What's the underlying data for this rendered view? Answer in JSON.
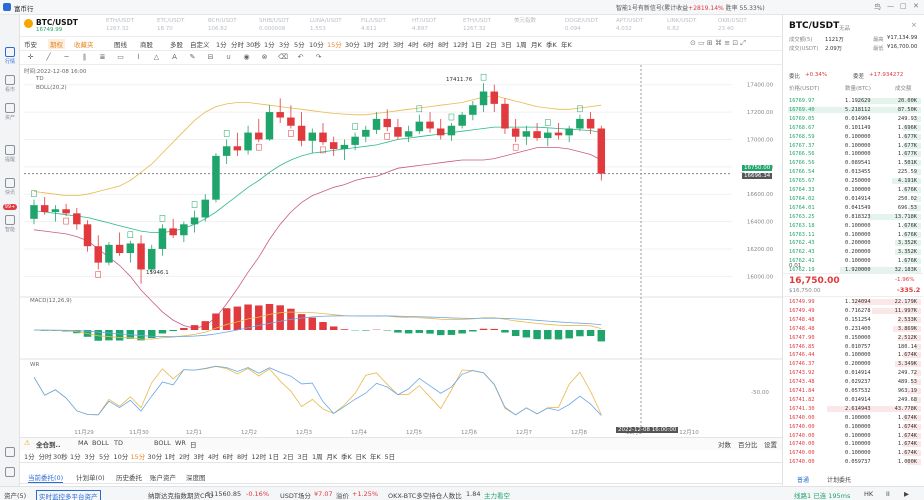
{
  "titlebar": {
    "app_name": "富币行",
    "notice": "智能1号有新信号(累计收益",
    "notice_value": "+2819.14%",
    "notice_tail": "胜率 55.33%)",
    "buttons": [
      "鸟",
      "—",
      "□",
      "✕"
    ]
  },
  "sidebar": {
    "items": [
      {
        "label": "行情",
        "icon": "chart-icon",
        "active": true
      },
      {
        "label": "看市",
        "icon": "eye-icon"
      },
      {
        "label": "资产",
        "icon": "wallet-icon"
      },
      {
        "label": "提醒",
        "icon": "bell-icon"
      },
      {
        "label": "快讯",
        "icon": "news-icon"
      },
      {
        "label": "99+",
        "icon": "badge-icon"
      },
      {
        "label": "智能",
        "icon": "robot-icon"
      }
    ]
  },
  "symbol": {
    "name": "BTC/USDT",
    "price": "16749.99"
  },
  "tickers": [
    {
      "name": "ETH/USDT",
      "price": "1267.32"
    },
    {
      "name": "ETC/USDT",
      "price": "18.70"
    },
    {
      "name": "BCH/USDT",
      "price": "106.82"
    },
    {
      "name": "SHIB/USDT",
      "price": "0.000008"
    },
    {
      "name": "LUNA/USDT",
      "price": "1.553"
    },
    {
      "name": "FIL/USDT",
      "price": "4.611"
    },
    {
      "name": "HT/USDT",
      "price": "4.897"
    },
    {
      "name": "ETH/USDT",
      "price": "1267.32"
    },
    {
      "name": "美元指数",
      "price": ""
    },
    {
      "name": "DOGE/USDT",
      "price": "0.094"
    },
    {
      "name": "APT/USDT",
      "price": "4.032"
    },
    {
      "name": "LINK/USDT",
      "price": "6.82"
    },
    {
      "name": "OKB/USDT",
      "price": "23.40"
    }
  ],
  "toolbar1": {
    "exchange": "币安",
    "contract": "期权",
    "fav": "收藏夹",
    "tabs": [
      "图线",
      "商股",
      "多股",
      "自定义"
    ],
    "intervals": [
      "1分",
      "分时",
      "30秒",
      "1分",
      "3分",
      "5分",
      "10分",
      "15分",
      "30分",
      "1时",
      "2时",
      "3时",
      "4时",
      "6时",
      "8时",
      "12时",
      "1日",
      "2日",
      "3日",
      "1周",
      "月K",
      "季K",
      "年K"
    ]
  },
  "chart": {
    "timestamp_label": "时间:2022-12-08 16:00",
    "indicator_td": "TD",
    "indicator_boll": "BOLL(20,2)",
    "macd_label": "MACD(12,26,9)",
    "wr_label": "WR",
    "high_label": "17411.76",
    "low_label": "15946.1",
    "current_price_tag": "16750.00",
    "secondary_price_tag": "16696.34",
    "crosshair_time": "2022-12-08 16:00:00",
    "y_ticks": [
      "17400.00",
      "17200.00",
      "17000.00",
      "16800.00",
      "16600.00",
      "16400.00",
      "16200.00",
      "16000.00"
    ],
    "wr_ticks": [
      "-50.00"
    ],
    "x_ticks": [
      "11月29",
      "11月30",
      "12月1",
      "12月2",
      "12月3",
      "12月4",
      "12月5",
      "12月6",
      "12月7",
      "12月8",
      "12月9",
      "12月10"
    ]
  },
  "chart_data": {
    "type": "candlestick",
    "timeframe": "4h",
    "candles": [
      [
        16420,
        16560,
        16380,
        16520
      ],
      [
        16520,
        16580,
        16450,
        16470
      ],
      [
        16470,
        16520,
        16400,
        16490
      ],
      [
        16490,
        16530,
        16440,
        16460
      ],
      [
        16460,
        16500,
        16340,
        16380
      ],
      [
        16380,
        16410,
        16180,
        16220
      ],
      [
        16220,
        16300,
        16050,
        16100
      ],
      [
        16100,
        16250,
        16080,
        16230
      ],
      [
        16230,
        16320,
        16150,
        16170
      ],
      [
        16170,
        16260,
        16100,
        16240
      ],
      [
        16240,
        16300,
        15946,
        16050
      ],
      [
        16050,
        16230,
        16020,
        16200
      ],
      [
        16200,
        16380,
        16150,
        16350
      ],
      [
        16350,
        16420,
        16280,
        16300
      ],
      [
        16300,
        16400,
        16250,
        16380
      ],
      [
        16380,
        16480,
        16320,
        16430
      ],
      [
        16430,
        16600,
        16400,
        16560
      ],
      [
        16560,
        16900,
        16540,
        16880
      ],
      [
        16880,
        17000,
        16820,
        16950
      ],
      [
        16950,
        17050,
        16880,
        16920
      ],
      [
        16920,
        17100,
        16890,
        17050
      ],
      [
        17050,
        17150,
        16980,
        17000
      ],
      [
        17000,
        17250,
        16990,
        17200
      ],
      [
        17200,
        17300,
        17120,
        17160
      ],
      [
        17160,
        17250,
        17080,
        17100
      ],
      [
        17100,
        17200,
        16950,
        16990
      ],
      [
        16990,
        17080,
        16900,
        17050
      ],
      [
        17050,
        17120,
        16960,
        16980
      ],
      [
        16980,
        17020,
        16880,
        16930
      ],
      [
        16930,
        17000,
        16850,
        16960
      ],
      [
        16960,
        17050,
        16920,
        17020
      ],
      [
        17020,
        17100,
        16980,
        17070
      ],
      [
        17070,
        17200,
        17040,
        17150
      ],
      [
        17150,
        17220,
        17060,
        17090
      ],
      [
        17090,
        17150,
        17000,
        17020
      ],
      [
        17020,
        17100,
        16980,
        17060
      ],
      [
        17060,
        17180,
        17040,
        17130
      ],
      [
        17130,
        17200,
        17050,
        17080
      ],
      [
        17080,
        17150,
        17000,
        17030
      ],
      [
        17030,
        17120,
        16990,
        17100
      ],
      [
        17100,
        17200,
        17080,
        17180
      ],
      [
        17180,
        17280,
        17140,
        17250
      ],
      [
        17250,
        17411,
        17200,
        17350
      ],
      [
        17350,
        17400,
        17200,
        17260
      ],
      [
        17260,
        17300,
        17040,
        17080
      ],
      [
        17080,
        17150,
        16980,
        17020
      ],
      [
        17020,
        17100,
        16960,
        17060
      ],
      [
        17060,
        17120,
        16990,
        17010
      ],
      [
        17010,
        17080,
        16950,
        17050
      ],
      [
        17050,
        17120,
        17000,
        17030
      ],
      [
        17030,
        17100,
        16980,
        17080
      ],
      [
        17080,
        17180,
        17060,
        17150
      ],
      [
        17150,
        17200,
        17040,
        17080
      ],
      [
        17080,
        17100,
        16700,
        16750
      ]
    ],
    "boll_upper": [
      16620,
      16610,
      16600,
      16590,
      16590,
      16600,
      16620,
      16640,
      16660,
      16700,
      16760,
      16820,
      16900,
      16980,
      17060,
      17140,
      17200,
      17240,
      17260,
      17270,
      17270,
      17260,
      17250,
      17240,
      17230,
      17220,
      17210,
      17200,
      17190,
      17185,
      17180,
      17180,
      17190,
      17200,
      17210,
      17220,
      17230,
      17240,
      17250,
      17260,
      17270,
      17290,
      17310,
      17320,
      17300,
      17280,
      17260,
      17240,
      17230,
      17220,
      17220,
      17230,
      17240,
      17250
    ],
    "boll_mid": [
      16480,
      16470,
      16460,
      16450,
      16440,
      16430,
      16410,
      16390,
      16370,
      16350,
      16330,
      16320,
      16320,
      16330,
      16350,
      16380,
      16420,
      16470,
      16530,
      16590,
      16650,
      16700,
      16760,
      16810,
      16850,
      16880,
      16900,
      16910,
      16920,
      16930,
      16940,
      16950,
      16960,
      16980,
      17000,
      17010,
      17020,
      17030,
      17040,
      17050,
      17060,
      17070,
      17080,
      17090,
      17090,
      17090,
      17090,
      17090,
      17085,
      17080,
      17075,
      17070,
      17065,
      17050
    ],
    "boll_lower": [
      16340,
      16330,
      16320,
      16310,
      16290,
      16260,
      16200,
      16140,
      16080,
      16000,
      15900,
      15820,
      15740,
      15680,
      15640,
      15620,
      15640,
      15700,
      15800,
      15910,
      16030,
      16140,
      16270,
      16380,
      16470,
      16540,
      16590,
      16620,
      16650,
      16670,
      16700,
      16720,
      16730,
      16760,
      16790,
      16800,
      16810,
      16820,
      16830,
      16840,
      16850,
      16850,
      16850,
      16860,
      16880,
      16900,
      16920,
      16940,
      16940,
      16940,
      16930,
      16910,
      16890,
      16850
    ],
    "y_range": [
      15900,
      17500
    ]
  },
  "toolbar_chart": {
    "buttons": [
      "+",
      "−"
    ]
  },
  "bottombar1": {
    "items": [
      "全仓到..",
      "MA",
      "BOLL",
      "TD",
      "BOLL",
      "WR",
      "日"
    ],
    "right": [
      "对数",
      "百分比",
      "设置"
    ]
  },
  "bottombar2": {
    "intervals": [
      "1分",
      "分时",
      "30秒",
      "1分",
      "3分",
      "5分",
      "10分",
      "15分",
      "30分",
      "1时",
      "2时",
      "3时",
      "4时",
      "6时",
      "8时",
      "12时",
      "1日",
      "2日",
      "3日",
      "1周",
      "月K",
      "季K",
      "日K",
      "年K",
      "5日"
    ]
  },
  "bottomtabs": {
    "tabs": [
      "当前委托(0)",
      "计划单(0)",
      "历史委托",
      "账户资产",
      "深度图"
    ]
  },
  "statusbar": {
    "items": [
      "资产(5)",
      "实时监控多平台资产",
      "纳斯达克指数期货CFD",
      "$11560.85",
      "-0.16%",
      "USDT场分",
      "¥7.07",
      "溢价",
      "+1.25%",
      "OKX-BTC多空持仓人数比",
      "1.84",
      "主力看空"
    ],
    "latency": "线路1 已连 195ms",
    "right": [
      "HK",
      "II",
      "▶"
    ]
  },
  "rightpanel": {
    "symbol": "BTC/USDT",
    "sub": "无品",
    "vol_label": "成交额(5)",
    "vol_value": "1121万",
    "trades_label": "成交(USDT)",
    "trades_value": "2.09万",
    "high_label": "最高",
    "high_value": "¥17,134.99",
    "low_label": "最低",
    "low_value": "¥16,700.00",
    "ratio_label": "委比",
    "ratio_value": "+0.34%",
    "diff_label": "委差",
    "diff_value": "+17.934272",
    "col_price": "价格(USDT)",
    "col_qty": "数量(BTC)",
    "col_total": "成交额",
    "asks": [
      [
        "16769.97",
        "1.192629",
        "20.00K"
      ],
      [
        "16769.40",
        "5.218112",
        "87.50K"
      ],
      [
        "16769.05",
        "0.014904",
        "249.93"
      ],
      [
        "16768.67",
        "0.101149",
        "1.696K"
      ],
      [
        "16768.59",
        "0.100000",
        "1.677K"
      ],
      [
        "16767.37",
        "0.100000",
        "1.677K"
      ],
      [
        "16766.56",
        "0.100000",
        "1.677K"
      ],
      [
        "16766.56",
        "0.089541",
        "1.501K"
      ],
      [
        "16766.54",
        "0.013455",
        "225.59"
      ],
      [
        "16765.67",
        "0.250000",
        "4.191K"
      ],
      [
        "16764.33",
        "0.100000",
        "1.676K"
      ],
      [
        "16764.02",
        "0.014914",
        "250.02"
      ],
      [
        "16764.01",
        "0.041549",
        "696.53"
      ],
      [
        "16763.25",
        "0.818323",
        "13.718K"
      ],
      [
        "16763.18",
        "0.100000",
        "1.676K"
      ],
      [
        "16763.11",
        "0.100000",
        "1.676K"
      ],
      [
        "16762.43",
        "0.200000",
        "3.352K"
      ],
      [
        "16762.43",
        "0.200000",
        "3.352K"
      ],
      [
        "16762.41",
        "0.100000",
        "1.676K"
      ],
      [
        "16762.19",
        "1.920000",
        "32.183K"
      ]
    ],
    "last_price": "16,750.00",
    "last_sub": "$16,750.00",
    "last_pct": "-1.96%",
    "last_change": "-335.2",
    "depth_label": "0.01",
    "bids": [
      [
        "16749.99",
        "1.324094",
        "22.179K"
      ],
      [
        "16749.49",
        "0.716278",
        "11.997K"
      ],
      [
        "16748.48",
        "0.151254",
        "2.533K"
      ],
      [
        "16748.48",
        "0.231400",
        "3.869K"
      ],
      [
        "16747.90",
        "0.150000",
        "2.512K"
      ],
      [
        "16746.85",
        "0.010757",
        "180.14"
      ],
      [
        "16746.44",
        "0.100000",
        "1.674K"
      ],
      [
        "16746.37",
        "0.200000",
        "3.349K"
      ],
      [
        "16743.92",
        "0.014914",
        "249.72"
      ],
      [
        "16743.48",
        "0.029237",
        "489.53"
      ],
      [
        "16741.84",
        "0.057532",
        "963.19"
      ],
      [
        "16741.82",
        "0.014914",
        "249.68"
      ],
      [
        "16741.30",
        "2.614943",
        "43.778K"
      ],
      [
        "16740.00",
        "0.100000",
        "1.674K"
      ],
      [
        "16740.00",
        "0.100000",
        "1.674K"
      ],
      [
        "16740.00",
        "0.100000",
        "1.674K"
      ],
      [
        "16740.00",
        "0.100000",
        "1.674K"
      ],
      [
        "16740.00",
        "0.100000",
        "1.674K"
      ],
      [
        "16740.00",
        "0.059737",
        "1.000K"
      ]
    ],
    "tabs": [
      "普通",
      "计划委托"
    ]
  }
}
